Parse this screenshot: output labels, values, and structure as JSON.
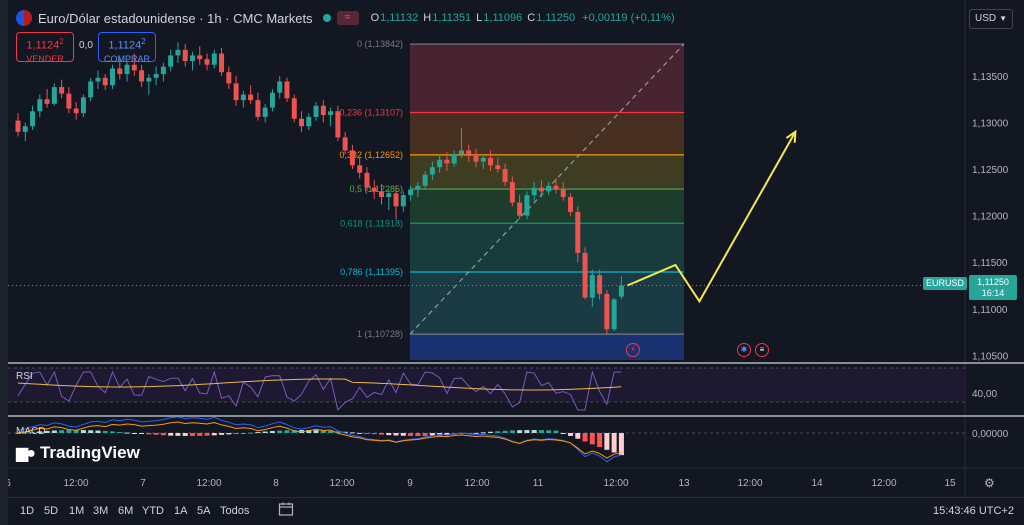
{
  "header": {
    "title": "Euro/Dólar estadounidense · 1h · CMC Markets",
    "ohlc": [
      {
        "key": "O",
        "value": "1,11132"
      },
      {
        "key": "H",
        "value": "1,11351"
      },
      {
        "key": "L",
        "value": "1,11096"
      },
      {
        "key": "C",
        "value": "1,11250"
      }
    ],
    "change": "+0,00119 (+0,11%)",
    "flag_icon": "eu-us-flag-icon",
    "chip_icon": "approx-icon"
  },
  "trade": {
    "sell_price": "1,1124",
    "sell_price_sup": "2",
    "sell_label": "VENDER",
    "spread": "0,0",
    "buy_price": "1,1124",
    "buy_price_sup": "2",
    "buy_label": "COMPRAR"
  },
  "currency": "USD",
  "symbol_tag": "EURUSD",
  "last_price": "1,11250",
  "countdown": "16:14",
  "price_axis": [
    "1,13500",
    "1,13000",
    "1,12500",
    "1,12000",
    "1,11500",
    "1,11000",
    "1,10500"
  ],
  "fib_levels": [
    {
      "label": "0 (1,13842)",
      "price": 1.13842,
      "color": "#787b86"
    },
    {
      "label": "0,236 (1,13107)",
      "price": 1.13107,
      "color": "#f23645"
    },
    {
      "label": "0,382 (1,12652)",
      "price": 1.12652,
      "color": "#ff9800"
    },
    {
      "label": "0,5 (1,12285)",
      "price": 1.12285,
      "color": "#4caf50"
    },
    {
      "label": "0,618 (1,11918)",
      "price": 1.11918,
      "color": "#089981"
    },
    {
      "label": "0,786 (1,11395)",
      "price": 1.11395,
      "color": "#00bcd4"
    },
    {
      "label": "1 (1,10728)",
      "price": 1.10728,
      "color": "#787b86"
    }
  ],
  "rsi": {
    "label": "RSI",
    "axis": "40,00"
  },
  "macd": {
    "label": "MACD",
    "axis": "0,00000"
  },
  "time_axis": [
    "6",
    "12:00",
    "7",
    "12:00",
    "8",
    "12:00",
    "9",
    "12:00",
    "11",
    "12:00",
    "13",
    "12:00",
    "14",
    "12:00",
    "15"
  ],
  "brand": "TradingView",
  "range_buttons": [
    "1D",
    "5D",
    "1M",
    "3M",
    "6M",
    "YTD",
    "1A",
    "5A",
    "Todos"
  ],
  "clock": "15:43:46 UTC+2",
  "colors": {
    "up": "#26a69a",
    "down": "#ef5350",
    "background": "#131722",
    "arrow": "#f5e94c"
  },
  "chart_data": {
    "type": "candlestick",
    "series_name": "EURUSD 1h",
    "ylim": [
      1.1045,
      1.1395
    ],
    "candles": [
      [
        1.1302,
        1.131,
        1.1285,
        1.129
      ],
      [
        1.129,
        1.13,
        1.128,
        1.1296
      ],
      [
        1.1296,
        1.1318,
        1.1292,
        1.1312
      ],
      [
        1.1312,
        1.133,
        1.1306,
        1.1325
      ],
      [
        1.1325,
        1.1336,
        1.1316,
        1.132
      ],
      [
        1.132,
        1.1342,
        1.1318,
        1.1338
      ],
      [
        1.1338,
        1.1346,
        1.1326,
        1.1331
      ],
      [
        1.1331,
        1.1338,
        1.131,
        1.1315
      ],
      [
        1.1315,
        1.1322,
        1.1303,
        1.131
      ],
      [
        1.131,
        1.133,
        1.1306,
        1.1327
      ],
      [
        1.1327,
        1.1348,
        1.1323,
        1.1344
      ],
      [
        1.1344,
        1.1356,
        1.1336,
        1.1348
      ],
      [
        1.1348,
        1.1352,
        1.1335,
        1.134
      ],
      [
        1.134,
        1.1362,
        1.1336,
        1.1358
      ],
      [
        1.1358,
        1.137,
        1.1346,
        1.1352
      ],
      [
        1.1352,
        1.1366,
        1.1344,
        1.1362
      ],
      [
        1.1362,
        1.1374,
        1.135,
        1.1356
      ],
      [
        1.1356,
        1.1362,
        1.1338,
        1.1344
      ],
      [
        1.1344,
        1.1352,
        1.133,
        1.1348
      ],
      [
        1.1348,
        1.136,
        1.134,
        1.1352
      ],
      [
        1.1352,
        1.1364,
        1.1344,
        1.136
      ],
      [
        1.136,
        1.1378,
        1.1355,
        1.1372
      ],
      [
        1.1372,
        1.1386,
        1.1364,
        1.1378
      ],
      [
        1.1378,
        1.1384,
        1.136,
        1.1366
      ],
      [
        1.1366,
        1.1376,
        1.1356,
        1.1372
      ],
      [
        1.1372,
        1.1382,
        1.1362,
        1.1368
      ],
      [
        1.1368,
        1.1374,
        1.1356,
        1.1362
      ],
      [
        1.1362,
        1.1378,
        1.1358,
        1.1374
      ],
      [
        1.1374,
        1.138,
        1.135,
        1.1354
      ],
      [
        1.1354,
        1.136,
        1.1336,
        1.1342
      ],
      [
        1.1342,
        1.135,
        1.1318,
        1.1324
      ],
      [
        1.1324,
        1.1334,
        1.1316,
        1.133
      ],
      [
        1.133,
        1.134,
        1.132,
        1.1324
      ],
      [
        1.1324,
        1.1332,
        1.1302,
        1.1306
      ],
      [
        1.1306,
        1.132,
        1.13,
        1.1316
      ],
      [
        1.1316,
        1.1336,
        1.1312,
        1.1332
      ],
      [
        1.1332,
        1.135,
        1.1326,
        1.1344
      ],
      [
        1.1344,
        1.1348,
        1.1322,
        1.1326
      ],
      [
        1.1326,
        1.133,
        1.13,
        1.1304
      ],
      [
        1.1304,
        1.1312,
        1.129,
        1.1296
      ],
      [
        1.1296,
        1.131,
        1.1292,
        1.1306
      ],
      [
        1.1306,
        1.1322,
        1.1302,
        1.1318
      ],
      [
        1.1318,
        1.1324,
        1.13,
        1.1308
      ],
      [
        1.1308,
        1.1316,
        1.1296,
        1.1312
      ],
      [
        1.1312,
        1.1318,
        1.128,
        1.1284
      ],
      [
        1.1284,
        1.129,
        1.1266,
        1.127
      ],
      [
        1.127,
        1.1276,
        1.125,
        1.1254
      ],
      [
        1.1254,
        1.1262,
        1.124,
        1.1246
      ],
      [
        1.1246,
        1.1252,
        1.1226,
        1.123
      ],
      [
        1.123,
        1.1238,
        1.1218,
        1.1226
      ],
      [
        1.1226,
        1.1234,
        1.1212,
        1.122
      ],
      [
        1.122,
        1.1228,
        1.1206,
        1.1224
      ],
      [
        1.1224,
        1.1232,
        1.1196,
        1.121
      ],
      [
        1.121,
        1.1226,
        1.1204,
        1.1222
      ],
      [
        1.1222,
        1.1232,
        1.1216,
        1.1228
      ],
      [
        1.1228,
        1.1236,
        1.122,
        1.1232
      ],
      [
        1.1232,
        1.1248,
        1.1228,
        1.1244
      ],
      [
        1.1244,
        1.1258,
        1.1238,
        1.1252
      ],
      [
        1.1252,
        1.1266,
        1.1246,
        1.126
      ],
      [
        1.126,
        1.1268,
        1.1248,
        1.1256
      ],
      [
        1.1256,
        1.127,
        1.1252,
        1.1266
      ],
      [
        1.1266,
        1.1294,
        1.1262,
        1.127
      ],
      [
        1.127,
        1.1276,
        1.1258,
        1.1264
      ],
      [
        1.1264,
        1.1272,
        1.1252,
        1.1258
      ],
      [
        1.1258,
        1.1266,
        1.125,
        1.1262
      ],
      [
        1.1262,
        1.127,
        1.1248,
        1.1254
      ],
      [
        1.1254,
        1.1262,
        1.1246,
        1.125
      ],
      [
        1.125,
        1.1256,
        1.1232,
        1.1236
      ],
      [
        1.1236,
        1.1242,
        1.121,
        1.1214
      ],
      [
        1.1214,
        1.1222,
        1.1196,
        1.12
      ],
      [
        1.12,
        1.1226,
        1.1196,
        1.1222
      ],
      [
        1.1222,
        1.1236,
        1.1216,
        1.123
      ],
      [
        1.123,
        1.1238,
        1.122,
        1.1226
      ],
      [
        1.1226,
        1.1236,
        1.1222,
        1.1232
      ],
      [
        1.1232,
        1.124,
        1.1224,
        1.1228
      ],
      [
        1.1228,
        1.1236,
        1.1216,
        1.122
      ],
      [
        1.122,
        1.1224,
        1.12,
        1.1204
      ],
      [
        1.1204,
        1.121,
        1.115,
        1.116
      ],
      [
        1.116,
        1.1166,
        1.111,
        1.1112
      ],
      [
        1.1112,
        1.1142,
        1.1102,
        1.1136
      ],
      [
        1.1136,
        1.1142,
        1.111,
        1.1116
      ],
      [
        1.1116,
        1.112,
        1.1072,
        1.1078
      ],
      [
        1.1078,
        1.1112,
        1.1076,
        1.111
      ],
      [
        1.1113,
        1.1135,
        1.111,
        1.1125
      ]
    ],
    "fib_top": 1.13842,
    "fib_bottom": 1.10728,
    "projection": [
      [
        1.1125,
        0
      ],
      [
        1.1147,
        4
      ],
      [
        1.1108,
        6
      ],
      [
        1.129,
        14
      ]
    ]
  }
}
